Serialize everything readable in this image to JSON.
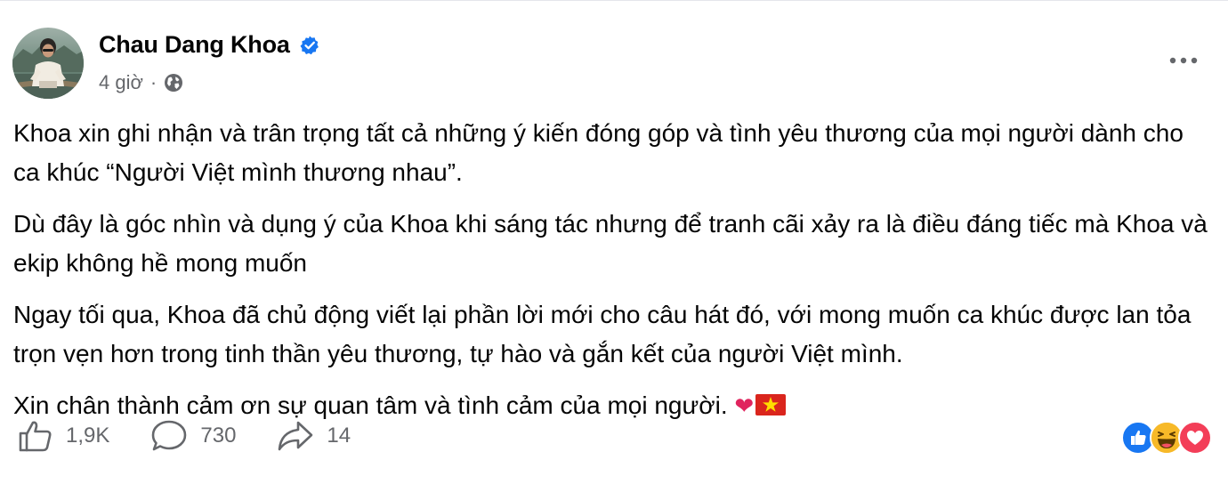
{
  "post": {
    "author": "Chau Dang Khoa",
    "time": "4 giờ",
    "dot": "·",
    "icons": {
      "verified": "verified-badge-icon",
      "audience": "globe-icon",
      "more": "more-options-icon"
    },
    "paragraphs": [
      "Khoa xin ghi nhận và trân trọng tất cả những ý kiến đóng góp và tình yêu thương của mọi người dành cho ca khúc “Người Việt mình thương nhau”.",
      "Dù đây là góc nhìn và dụng ý của Khoa khi sáng tác nhưng để tranh cãi xảy ra là điều đáng tiếc mà Khoa và ekip không hề mong muốn",
      "Ngay tối qua, Khoa đã chủ động viết lại phần lời mới cho câu hát đó, với mong muốn ca khúc được lan tỏa trọn vẹn hơn trong tinh thần yêu thương, tự hào và gắn kết của người Việt mình.",
      "Xin chân thành cảm ơn sự quan tâm và tình cảm của mọi người."
    ],
    "closing_emojis": [
      "heart-emoji",
      "vietnam-flag-emoji"
    ]
  },
  "actions": {
    "likes": "1,9K",
    "comments": "730",
    "shares": "14"
  },
  "reactions": [
    "like-reaction",
    "haha-reaction",
    "love-reaction"
  ],
  "colors": {
    "text": "#050505",
    "secondary": "#65676b",
    "brand_blue": "#1877f2",
    "love_red": "#f33e58",
    "haha_yellow": "#f7b928"
  }
}
